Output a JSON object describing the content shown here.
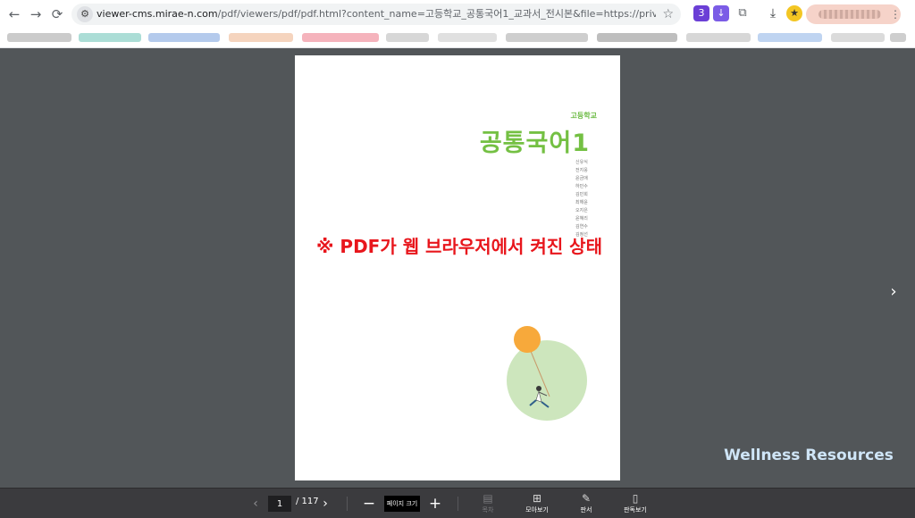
{
  "browser": {
    "url_host": "viewer-cms.mirae-n.com",
    "url_path": "/pdf/viewers/pdf/pdf.html?content_name=고등학교_공통국어1_교과서_전시본&file=https://privw-cms.mirae-n.com/docum...",
    "icons": {
      "back": "←",
      "forward": "→",
      "reload": "⟳",
      "tune": "⚙",
      "star": "☆",
      "download": "⤓",
      "kebab": "⋮"
    },
    "extension_badge": "3"
  },
  "document": {
    "subtitle": "고등학교",
    "title": "공통국어1",
    "authors": [
      "신유식",
      "전지웅",
      "윤금애",
      "하민수",
      "김민희",
      "최해윤",
      "오지은",
      "윤혜리",
      "김연수",
      "김정선"
    ],
    "overlay_text": "※ PDF가 웹 브라우저에서 켜진 상태",
    "illustration": {
      "balloon_color": "#f7a93b",
      "circle_color": "#cde6bd"
    }
  },
  "viewer": {
    "next_arrow": "›",
    "watermark": "Wellness Resources"
  },
  "toolbar": {
    "prev_arrow": "‹",
    "next_arrow": "›",
    "current_page": "1",
    "total_pages": "/ 117",
    "zoom_out": "−",
    "zoom_in": "+",
    "zoom_label": "페이지 크기",
    "tools": [
      {
        "label": "목차",
        "icon": "▤",
        "enabled": false
      },
      {
        "label": "모아보기",
        "icon": "⊞",
        "enabled": true
      },
      {
        "label": "판서",
        "icon": "✎",
        "enabled": true
      },
      {
        "label": "판독보기",
        "icon": "▯",
        "enabled": true
      }
    ]
  }
}
